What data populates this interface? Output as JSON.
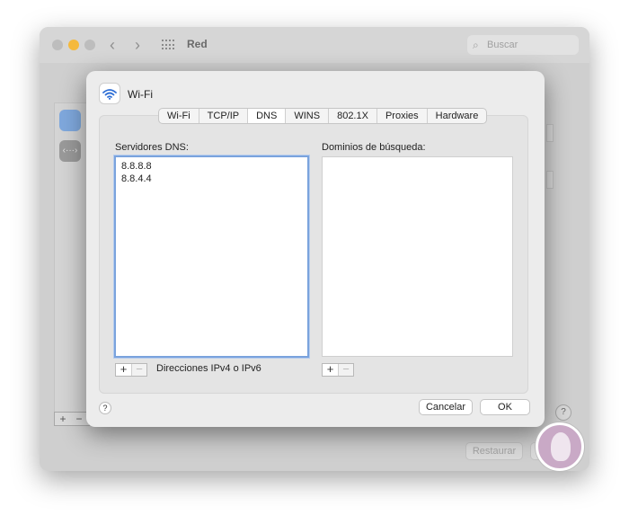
{
  "background_window": {
    "title": "Red",
    "search_placeholder": "Buscar",
    "restore_label": "Restaurar",
    "plus_label": "+",
    "minus_label": "−",
    "help_label": "?"
  },
  "dialog": {
    "title": "Wi-Fi",
    "tabs": [
      {
        "label": "Wi-Fi",
        "active": false
      },
      {
        "label": "TCP/IP",
        "active": false
      },
      {
        "label": "DNS",
        "active": true
      },
      {
        "label": "WINS",
        "active": false
      },
      {
        "label": "802.1X",
        "active": false
      },
      {
        "label": "Proxies",
        "active": false
      },
      {
        "label": "Hardware",
        "active": false
      }
    ],
    "dns_servers": {
      "label": "Servidores DNS:",
      "entries": [
        "8.8.8.8",
        "8.8.4.4"
      ],
      "hint": "Direcciones IPv4 o IPv6"
    },
    "search_domains": {
      "label": "Dominios de búsqueda:"
    },
    "plus_label": "+",
    "minus_label": "−",
    "help_label": "?",
    "cancel_label": "Cancelar",
    "ok_label": "OK"
  },
  "colors": {
    "accent": "#7aa3dd",
    "wifi_icon": "#2f6fd6",
    "traffic_minimize": "#f5b93c"
  },
  "icons": [
    "wifi-icon",
    "search-icon",
    "grid-icon",
    "back-arrow-icon",
    "forward-arrow-icon",
    "help-icon"
  ]
}
